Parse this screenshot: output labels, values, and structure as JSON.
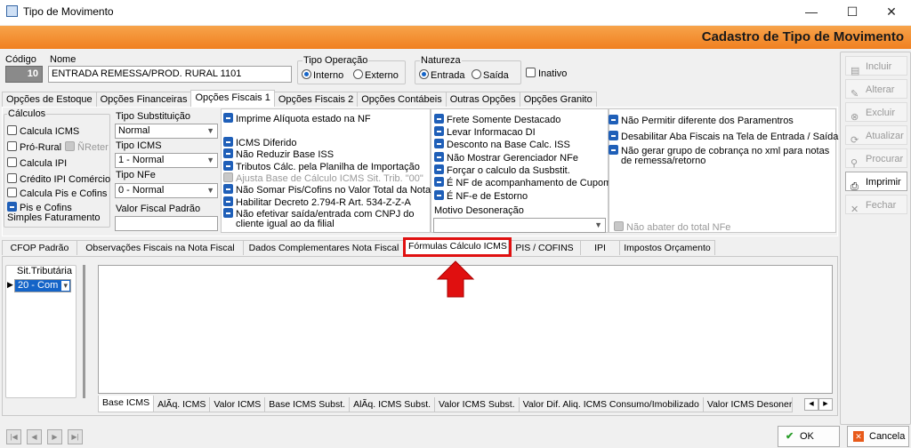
{
  "window": {
    "title": "Tipo de Movimento",
    "min": "—",
    "max": "☐",
    "close": "✕"
  },
  "header": {
    "title": "Cadastro de Tipo de Movimento"
  },
  "form": {
    "codigo_label": "Código",
    "codigo_value": "10",
    "nome_label": "Nome",
    "nome_value": "ENTRADA REMESSA/PROD. RURAL 1101",
    "tipo_op_label": "Tipo Operação",
    "tipo_op_interno": "Interno",
    "tipo_op_externo": "Externo",
    "natureza_label": "Natureza",
    "nat_entrada": "Entrada",
    "nat_saida": "Saída",
    "inativo": "Inativo"
  },
  "tabs_top": [
    "Opções de Estoque",
    "Opções Financeiras",
    "Opções Fiscais 1",
    "Opções Fiscais 2",
    "Opções Contábeis",
    "Outras Opções",
    "Opções Granito"
  ],
  "calc": {
    "title": "Cálculos",
    "icms": "Calcula ICMS",
    "prorural": "Pró-Rural",
    "nreter": "ÑReter",
    "ipi": "Calcula IPI",
    "credito": "Crédito IPI Comércio",
    "piscofins": "Calcula Pis e Cofins",
    "pissimples": "Pis e Cofins Simples Faturamento"
  },
  "tipos": {
    "subst_label": "Tipo Substituição",
    "subst_value": "Normal",
    "icms_label": "Tipo ICMS",
    "icms_value": "1 - Normal",
    "nfe_label": "Tipo NFe",
    "nfe_value": "0 - Normal",
    "vfp_label": "Valor Fiscal Padrão"
  },
  "col3": [
    "Imprime Alíquota estado na NF",
    "ICMS Diferido",
    "Não Reduzir Base ISS",
    "Tributos Cálc. pela Planilha de Importação",
    "Ajusta Base de Cálculo ICMS Sit. Trib. \"00\"",
    "Não Somar Pis/Cofins no Valor Total da Nota",
    "Habilitar Decreto 2.794-R Art. 534-Z-Z-A",
    "Não efetivar saída/entrada com CNPJ do cliente igual ao da filial"
  ],
  "col4": [
    "Frete Somente Destacado",
    "Levar Informacao DI",
    "Desconto na Base Calc. ISS",
    "Não Mostrar Gerenciador NFe",
    "Forçar o calculo da Susbstit.",
    "É NF de acompanhamento de Cupom",
    "É NF-e de Estorno"
  ],
  "motivo_label": "Motivo Desoneração",
  "col5": [
    "Não Permitir diferente dos Paramentros",
    "Desabilitar Aba Fiscais na Tela de Entrada / Saída",
    "Não gerar grupo de cobrança no xml para notas de remessa/retorno"
  ],
  "nao_abater": "Não abater do total NFe",
  "tabs_mid": [
    "CFOP Padrão",
    "Observações Fiscais na Nota Fiscal",
    "Dados Complementares Nota Fiscal",
    "Fórmulas Cálculo ICMS",
    "PIS / COFINS",
    "IPI",
    "Impostos Orçamento"
  ],
  "sit": {
    "label": "Sit.Tributária",
    "value": "20 - Com"
  },
  "tabs_bot": [
    "Base ICMS",
    "AlÃ­q. ICMS",
    "Valor ICMS",
    "Base ICMS Subst.",
    "AlÃ­q. ICMS Subst.",
    "Valor ICMS Subst.",
    "Valor Dif. Aliq. ICMS Consumo/Imobilizado",
    "Valor ICMS Desonerac"
  ],
  "side": [
    "Incluir",
    "Alterar",
    "Excluir",
    "Atualizar",
    "Procurar",
    "Imprimir",
    "Fechar"
  ],
  "footer": {
    "ok": "OK",
    "cancel": "Cancela"
  },
  "colors": {
    "accent": "#f08020",
    "highlight": "#e01010",
    "check": "#1f5fb8"
  }
}
